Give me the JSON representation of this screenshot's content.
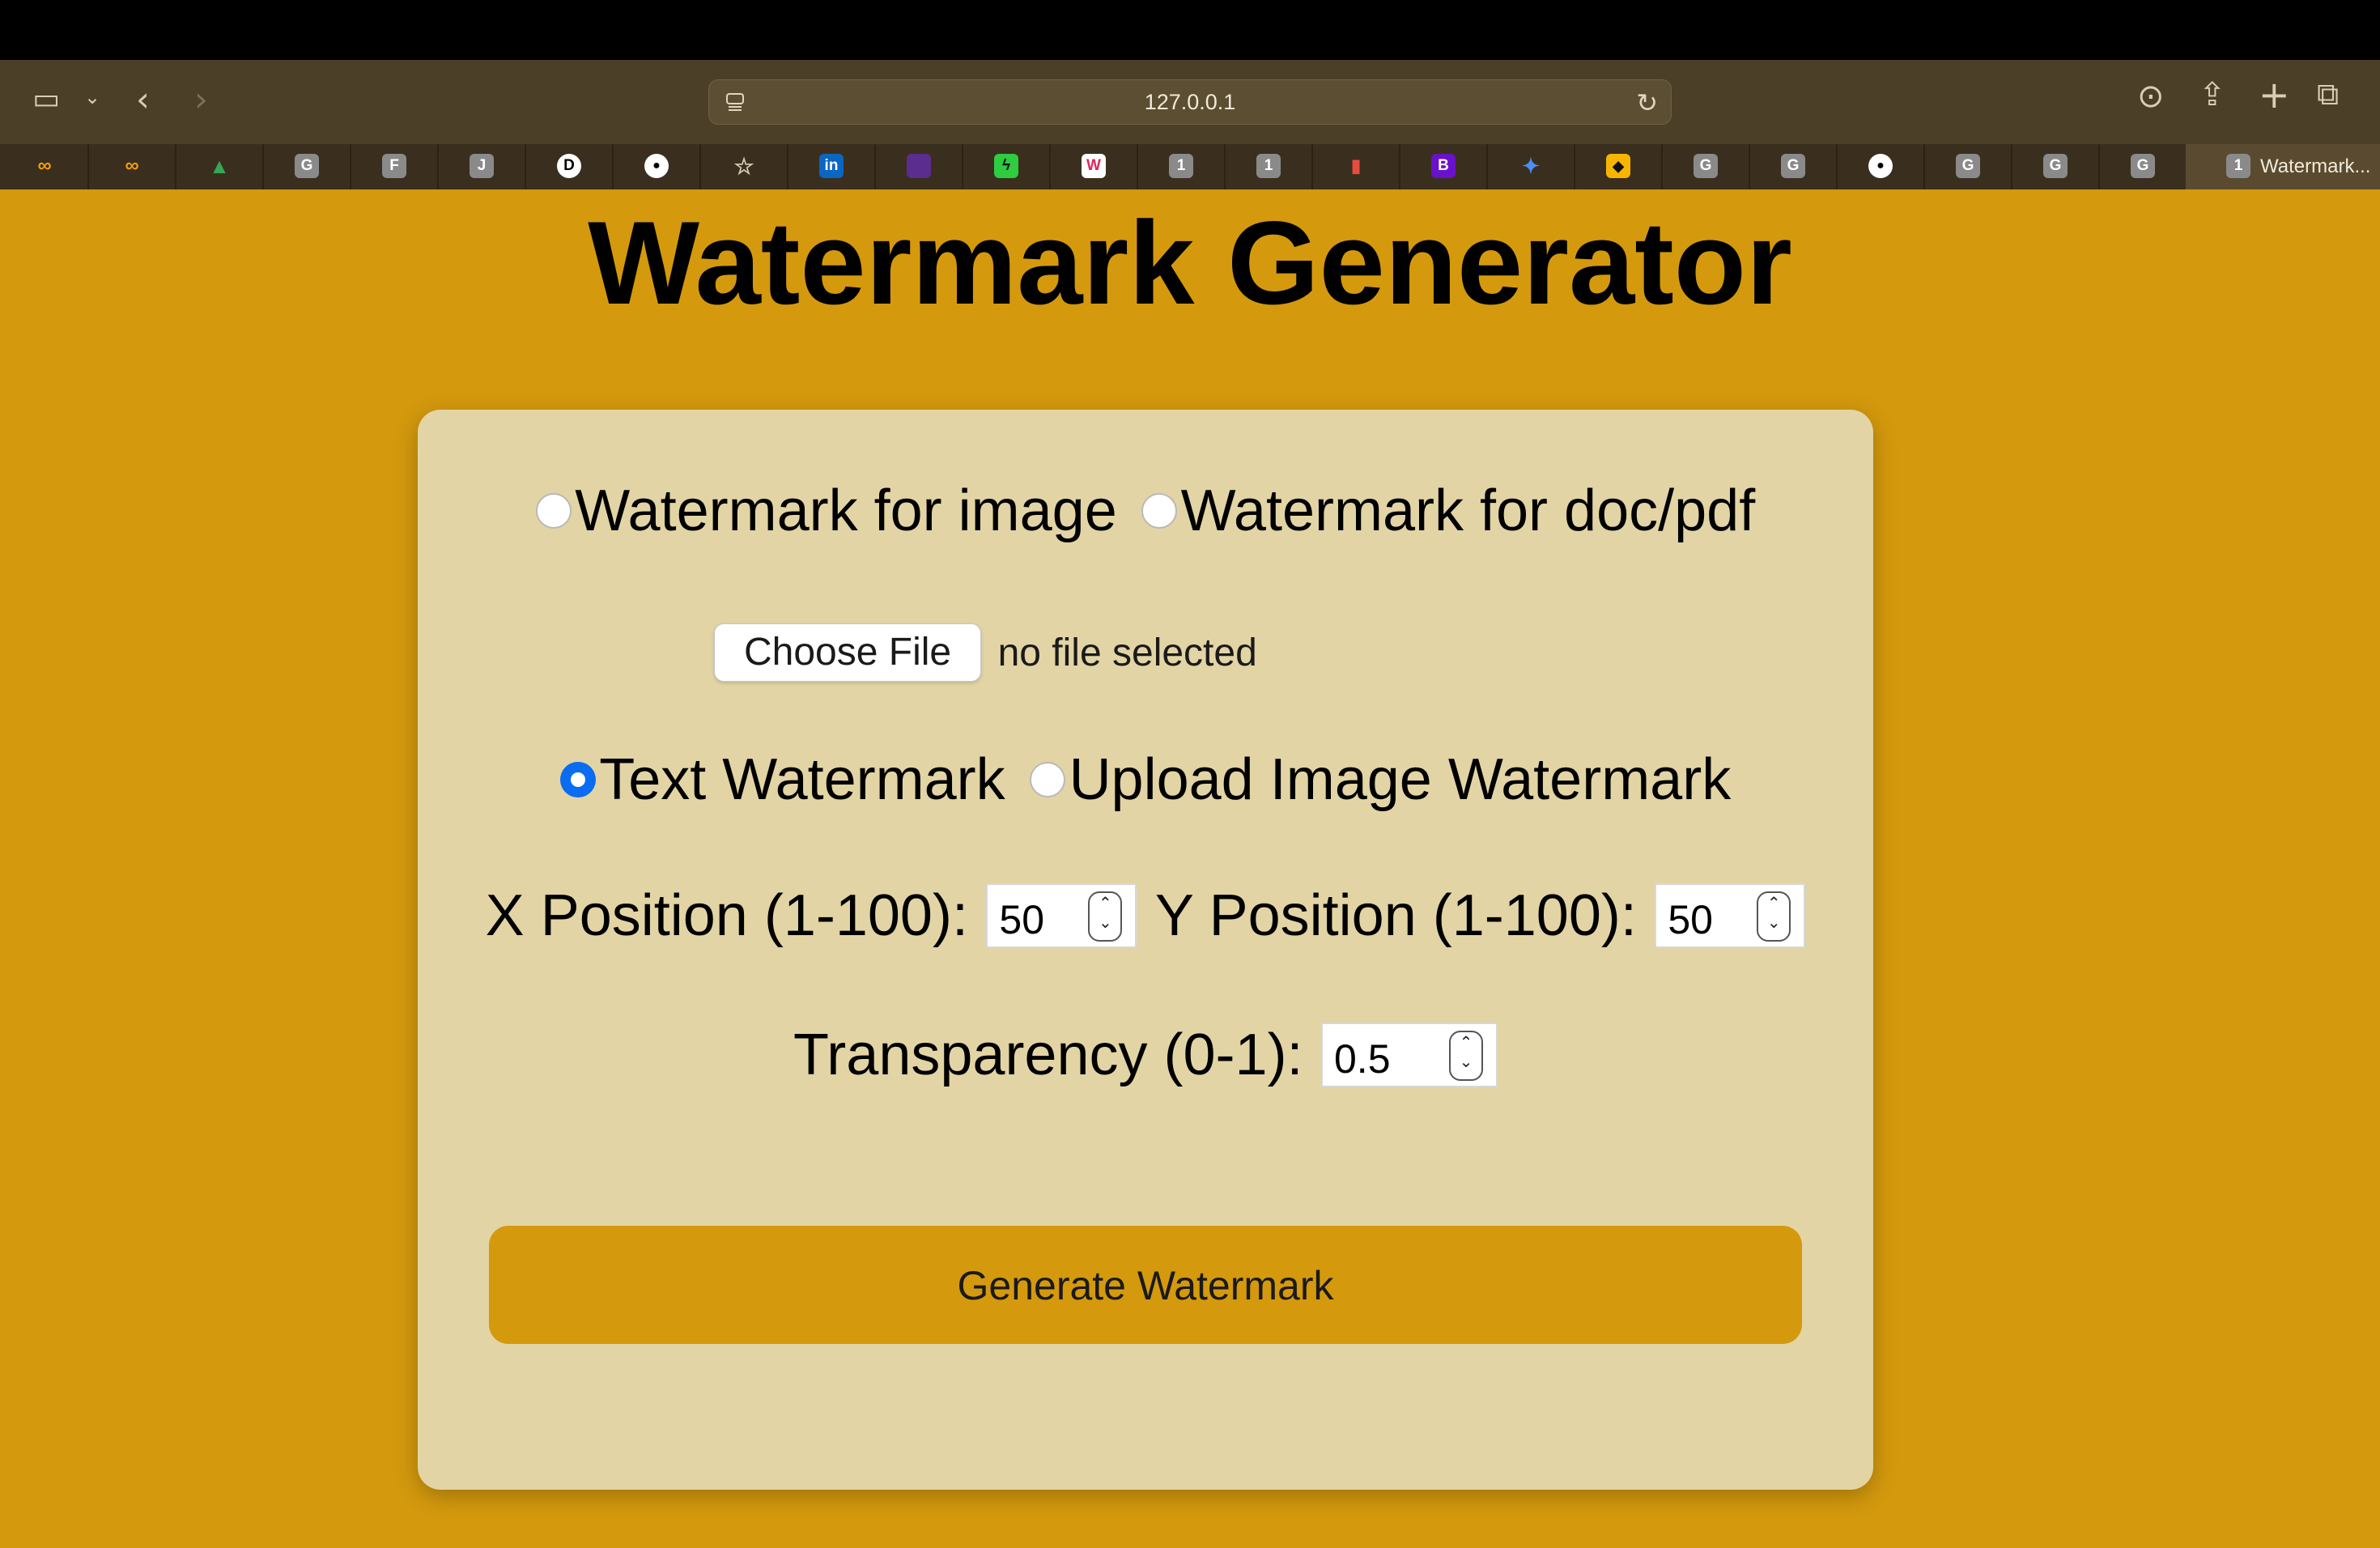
{
  "browser": {
    "address": "127.0.0.1",
    "tab_badges": [
      "G",
      "F",
      "J",
      "D",
      "1",
      "1",
      "B",
      "G",
      "G",
      "G",
      "G",
      "G"
    ],
    "active_tab": {
      "badge": "1",
      "title": "Watermark..."
    }
  },
  "page": {
    "title": "Watermark Generator",
    "mode_options": [
      "Watermark for image",
      "Watermark for doc/pdf"
    ],
    "file": {
      "button": "Choose File",
      "status": "no file selected"
    },
    "type_options": [
      "Text Watermark",
      "Upload Image Watermark"
    ],
    "x_label": "X Position (1-100):",
    "x_value": "50",
    "y_label": "Y Position (1-100):",
    "y_value": "50",
    "transparency_label": "Transparency (0-1):",
    "transparency_value": "0.5",
    "generate_button": "Generate Watermark"
  },
  "colors": {
    "background": "#d4990d",
    "card": "#e2d4a4",
    "radio_checked": "#0a6cf0"
  }
}
